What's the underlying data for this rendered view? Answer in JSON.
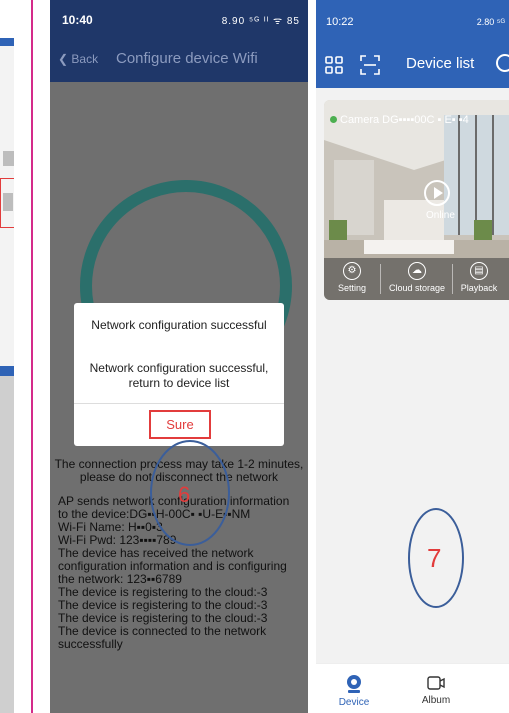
{
  "middle_screen": {
    "status_time": "10:40",
    "status_icons": "8.90 ⁵ᴳ ᴵᴵ ᯤ 85",
    "back_label": "Back",
    "title": "Configure device Wifi",
    "dialog": {
      "title": "Network configuration successful",
      "message": "Network configuration successful, return to device list",
      "button": "Sure"
    },
    "info_lines": [
      "The connection process may take 1-2 minutes,",
      "please do not disconnect the network"
    ],
    "log_lines": [
      "AP sends network configuration information",
      "to the device:DG▪▪H-00C▪ ▪U-E▪▪NM",
      "Wi-Fi Name: H▪▪0▪3",
      "Wi-Fi Pwd: 123▪▪▪▪789",
      "The device has received the network",
      "configuration information and is configuring",
      "the network: 123▪▪6789",
      "The device is registering to the cloud:-3",
      "The device is registering to the cloud:-3",
      "The device is registering to the cloud:-3",
      "The device is connected to the network",
      "successfully"
    ],
    "step_number": "6",
    "accent_color": "#e23c3c"
  },
  "right_screen": {
    "status_time": "10:22",
    "status_icons": "2.80 ⁵ᴳ",
    "title": "Device list",
    "camera_label": "Camera DG▪▪▪▪00C ▪ E▪ ▪4",
    "online_label": "Online",
    "toolbar": [
      {
        "label": "Setting",
        "icon": "gear-icon"
      },
      {
        "label": "Cloud storage",
        "icon": "cloud-icon"
      },
      {
        "label": "Playback",
        "icon": "playback-icon"
      }
    ],
    "step_number": "7",
    "tabs": [
      {
        "label": "Device",
        "icon": "camera-icon",
        "active": true
      },
      {
        "label": "Album",
        "icon": "album-icon",
        "active": false
      }
    ],
    "brand_color": "#2f63b6"
  }
}
